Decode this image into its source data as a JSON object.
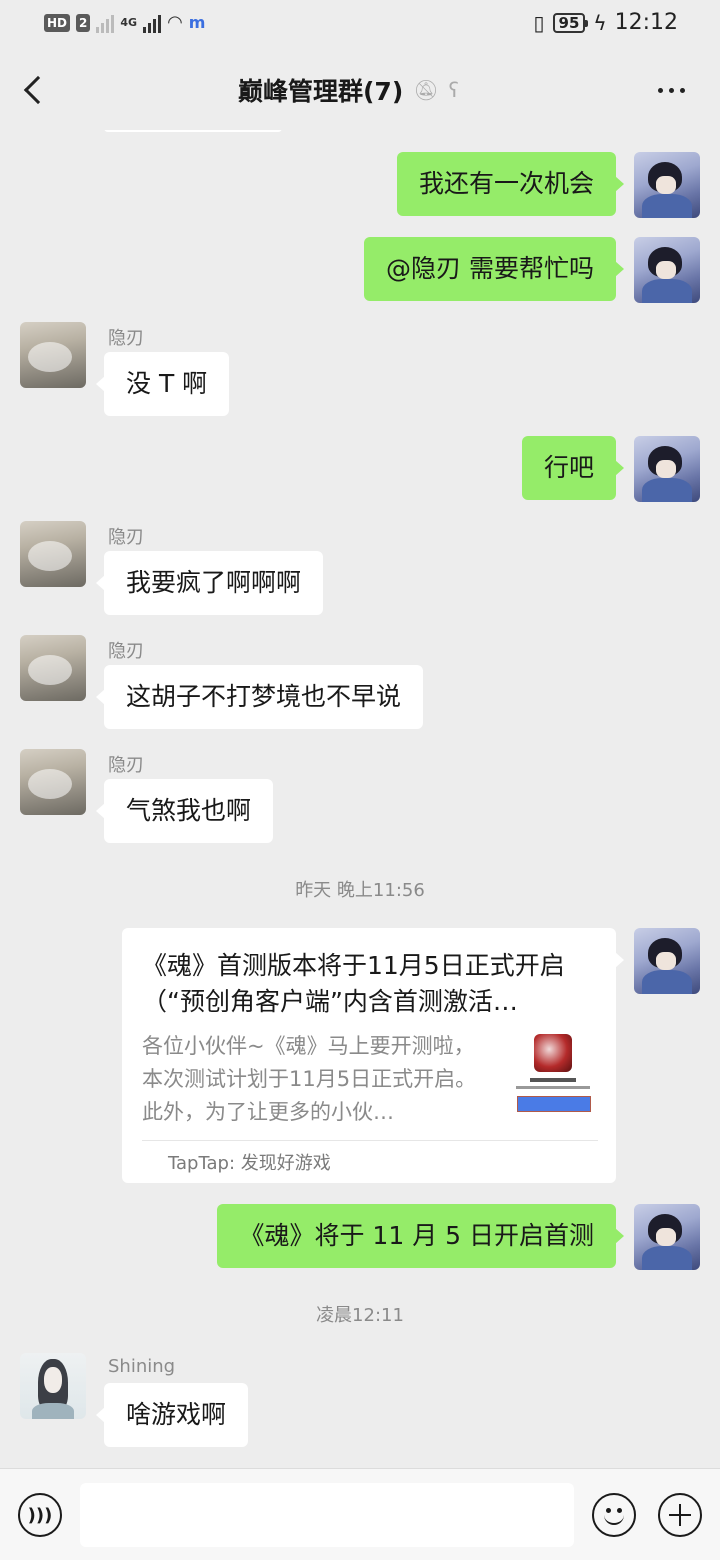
{
  "status_bar": {
    "hd_badge": "HD",
    "sim_badge": "2",
    "network": "4G",
    "battery": "95",
    "time": "12:12",
    "icons": [
      "signal-icon",
      "wifi-icon",
      "vibrate-icon",
      "battery-icon",
      "charging-icon"
    ]
  },
  "header": {
    "title": "巅峰管理群(7)",
    "icons": [
      "back-icon",
      "mute-icon",
      "earpiece-icon",
      "more-icon"
    ]
  },
  "messages": [
    {
      "from": "me",
      "text": "我还有一次机会"
    },
    {
      "from": "me",
      "text": "@隐刃  需要帮忙吗"
    },
    {
      "from": "other",
      "sender": "隐刃",
      "text": "没 T 啊"
    },
    {
      "from": "me",
      "text": "行吧"
    },
    {
      "from": "other",
      "sender": "隐刃",
      "text": "我要疯了啊啊啊"
    },
    {
      "from": "other",
      "sender": "隐刃",
      "text": "这胡子不打梦境也不早说"
    },
    {
      "from": "other",
      "sender": "隐刃",
      "text": "气煞我也啊"
    },
    {
      "from": "me",
      "text": "《魂》将于 11 月 5 日开启首测"
    },
    {
      "from": "other",
      "sender": "Shining",
      "text": "啥游戏啊"
    }
  ],
  "timestamps": [
    "昨天 晚上11:56",
    "凌晨12:11"
  ],
  "link_card": {
    "title": "《魂》首测版本将于11月5日正式开启（“预创角客户端”内含首测激活…",
    "description": "各位小伙伴~《魂》马上要开测啦，本次测试计划于11月5日正式开启。此外，为了让更多的小伙…",
    "source": "TapTap: 发现好游戏"
  },
  "input_bar": {
    "placeholder": "",
    "icons": [
      "voice-icon",
      "emoji-icon",
      "plus-icon"
    ]
  },
  "colors": {
    "background": "#ededed",
    "my_bubble": "#95ec69",
    "other_bubble": "#ffffff",
    "meta_text": "#8a8a8a"
  }
}
